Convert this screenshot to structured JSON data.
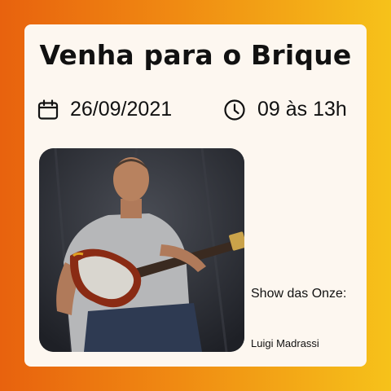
{
  "title": "Venha para o Brique",
  "event": {
    "date": "26/09/2021",
    "time": "09 às 13h",
    "date_icon": "calendar-icon",
    "time_icon": "clock-icon"
  },
  "show": {
    "label": "Show das Onze:",
    "artist": "Luigi Madrassi"
  },
  "colors": {
    "gradient_left": "#e8620e",
    "gradient_right": "#f6c21a",
    "card_background": "#fdf7f0",
    "text": "#111111"
  }
}
